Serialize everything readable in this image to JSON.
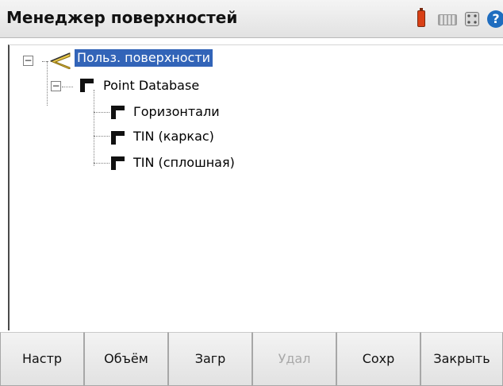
{
  "window": {
    "title": "Менеджер поверхностей"
  },
  "status_icons": [
    "battery-icon",
    "keyboard-icon",
    "apps-icon",
    "help-icon"
  ],
  "help_glyph": "?",
  "tree": {
    "root": {
      "label": "Польз. поверхности",
      "expander": "−",
      "icon": "user-surfaces-icon",
      "selected": true
    },
    "database": {
      "label": "Point Database",
      "expander": "−",
      "icon": "surface-icon"
    },
    "children": [
      {
        "label": "Горизонтали",
        "icon": "surface-icon"
      },
      {
        "label": "TIN (каркас)",
        "icon": "surface-icon"
      },
      {
        "label": "TIN (сплошная)",
        "icon": "surface-icon"
      }
    ]
  },
  "toolbar": {
    "buttons": [
      {
        "label": "Настр",
        "enabled": true
      },
      {
        "label": "Объём",
        "enabled": true
      },
      {
        "label": "Загр",
        "enabled": true
      },
      {
        "label": "Удал",
        "enabled": false
      },
      {
        "label": "Сохр",
        "enabled": true
      },
      {
        "label": "Закрыть",
        "enabled": true
      }
    ]
  },
  "colors": {
    "selection": "#3264b8",
    "disabled_text": "#a9a9a9",
    "battery": "#d94016",
    "help": "#1f6dbf"
  }
}
